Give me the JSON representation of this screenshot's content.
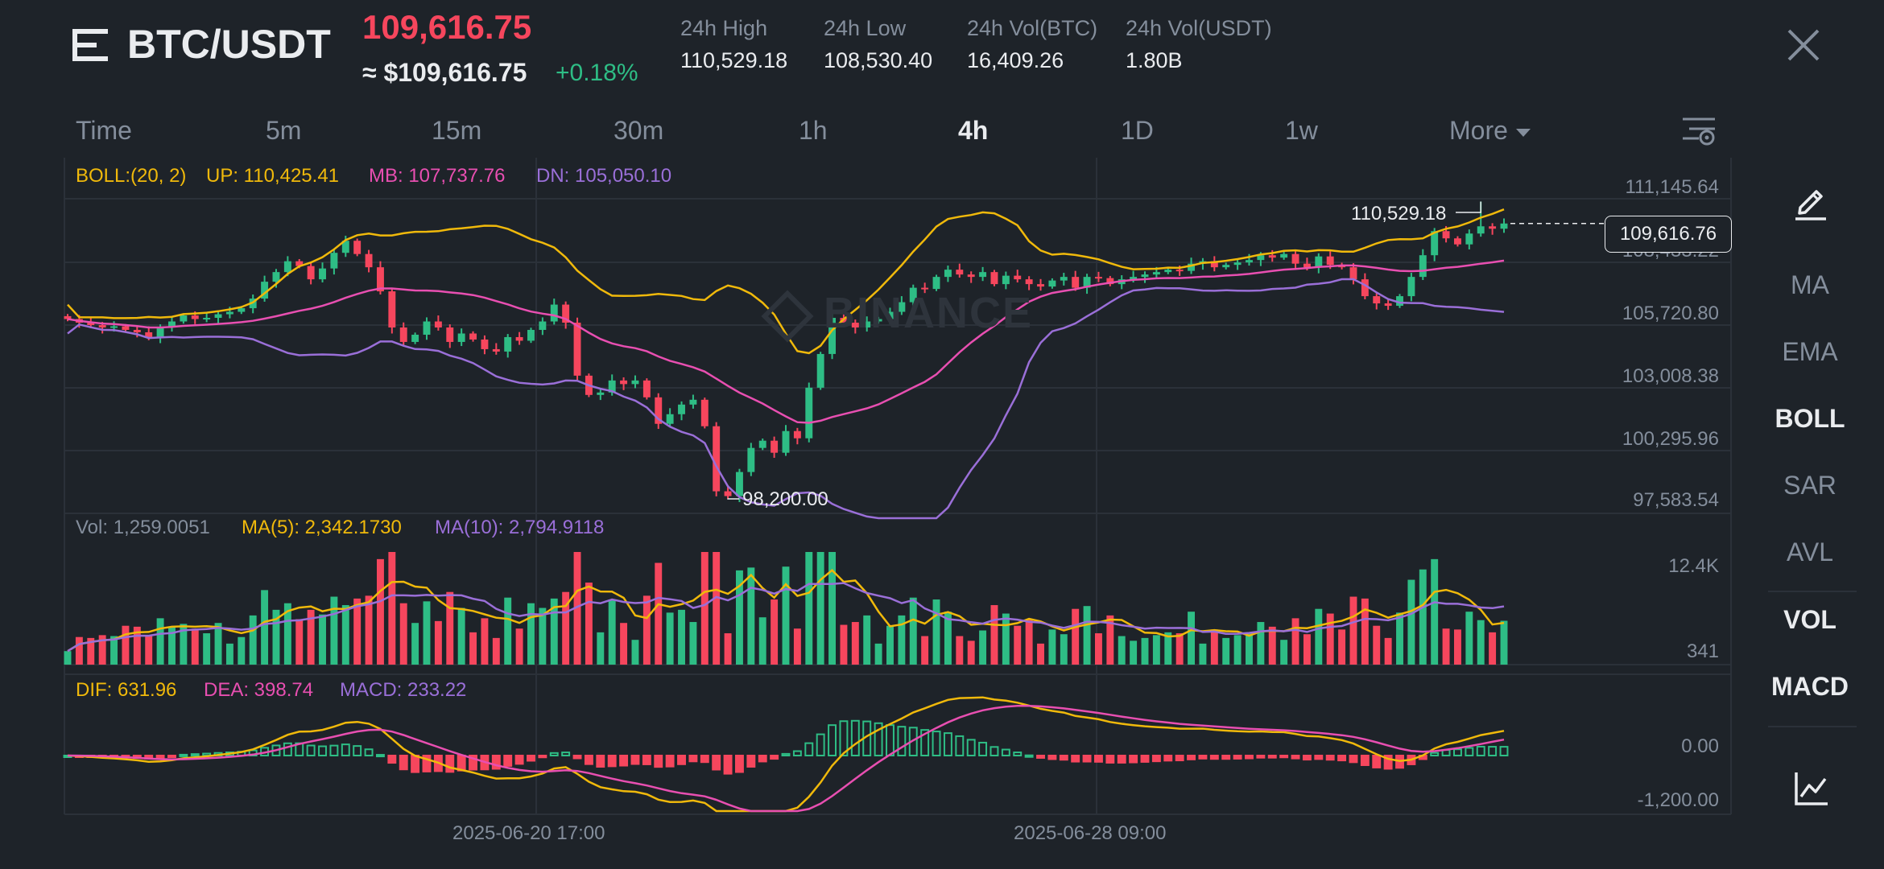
{
  "header": {
    "menu_icon": "hamburger-menu-icon",
    "pair": "BTC/USDT",
    "last_price": "109,616.75",
    "usd_price": "≈ $109,616.75",
    "change_pct": "+0.18%",
    "close_icon": "close-icon",
    "stats": [
      {
        "label": "24h High",
        "value": "110,529.18"
      },
      {
        "label": "24h Low",
        "value": "108,530.40"
      },
      {
        "label": "24h Vol(BTC)",
        "value": "16,409.26"
      },
      {
        "label": "24h Vol(USDT)",
        "value": "1.80B"
      }
    ]
  },
  "intervals": [
    "Time",
    "5m",
    "15m",
    "30m",
    "1h",
    "4h",
    "1D",
    "1w",
    "More"
  ],
  "active_interval": "4h",
  "chart_settings_icon": "chart-settings-icon",
  "legends": {
    "boll": {
      "label": "BOLL:(20, 2)",
      "up": "UP: 110,425.41",
      "mb": "MB: 107,737.76",
      "dn": "DN: 105,050.10"
    },
    "vol": {
      "label": "Vol: 1,259.0051",
      "ma5": "MA(5): 2,342.1730",
      "ma10": "MA(10): 2,794.9118"
    },
    "macd": {
      "dif": "DIF: 631.96",
      "dea": "DEA: 398.74",
      "macd": "MACD: 233.22"
    }
  },
  "price_axis": [
    "111,145.64",
    "108,433.22",
    "105,720.80",
    "103,008.38",
    "100,295.96",
    "97,583.54"
  ],
  "volume_axis": [
    "12.4K",
    "341"
  ],
  "macd_axis": [
    "0.00",
    "-1,200.00"
  ],
  "current_price_tag": "109,616.76",
  "annotations": {
    "high": "110,529.18",
    "low": "98,200.00"
  },
  "date_labels": [
    "2025-06-20 17:00",
    "2025-06-28 09:00"
  ],
  "watermark": "BINANCE",
  "side_indicators": [
    "MA",
    "EMA",
    "BOLL",
    "SAR",
    "AVL",
    "VOL",
    "MACD"
  ],
  "active_indicators": [
    "BOLL",
    "VOL",
    "MACD"
  ],
  "side_icons": {
    "draw": "pencil-draw-icon",
    "chart_type": "line-chart-icon"
  },
  "colors": {
    "bg": "#1e2329",
    "up": "#2ebd85",
    "down": "#f6465d",
    "text": "#eaecef",
    "muted": "#848e9c",
    "boll_up": "#f0b90b",
    "boll_mb": "#e84fb1",
    "boll_dn": "#9a6fd8",
    "grid": "#2b3139"
  },
  "chart_data": {
    "type": "candlestick",
    "price_ylim": [
      97583.54,
      111145.64
    ],
    "high": 110529.18,
    "low": 98200.0,
    "current": 109616.76,
    "closes": [
      105650,
      105500,
      105400,
      105300,
      105350,
      105200,
      105100,
      104900,
      105300,
      105550,
      105800,
      105650,
      105700,
      105850,
      105950,
      106100,
      106500,
      107200,
      107600,
      108050,
      107850,
      107300,
      107750,
      108400,
      108900,
      108350,
      107800,
      106800,
      105300,
      104700,
      105000,
      105550,
      105300,
      104700,
      105050,
      104800,
      104400,
      104300,
      104900,
      104750,
      105200,
      105550,
      106250,
      105500,
      103300,
      102500,
      102600,
      103100,
      102950,
      103100,
      102400,
      101300,
      101700,
      102100,
      102300,
      101200,
      98500,
      98300,
      99300,
      100300,
      100600,
      100100,
      101000,
      100700,
      102800,
      104200,
      105700,
      105500,
      105300,
      105550,
      105650,
      105950,
      106350,
      106950,
      106900,
      107400,
      107700,
      107500,
      107400,
      107600,
      107100,
      107450,
      107300,
      107100,
      107000,
      107250,
      107400,
      106950,
      107400,
      107350,
      107100,
      107300,
      107400,
      107500,
      107600,
      107700,
      107650,
      107950,
      108050,
      107800,
      107900,
      108000,
      108100,
      108300,
      108200,
      108350,
      107950,
      107800,
      108250,
      107900,
      107800,
      107300,
      106600,
      106300,
      106200,
      106600,
      107400,
      108300,
      109300,
      109000,
      108750,
      109200,
      109500,
      109400,
      109616.76
    ],
    "boll_up": [
      110425.41
    ],
    "boll_mb": [
      107737.76
    ],
    "boll_dn": [
      105050.1
    ],
    "volume": [
      1259.0051
    ],
    "volume_ma5": [
      2342.173
    ],
    "volume_ma10": [
      2794.9118
    ],
    "macd_dif": [
      631.96
    ],
    "macd_dea": [
      398.74
    ],
    "macd_hist": [
      233.22
    ]
  }
}
